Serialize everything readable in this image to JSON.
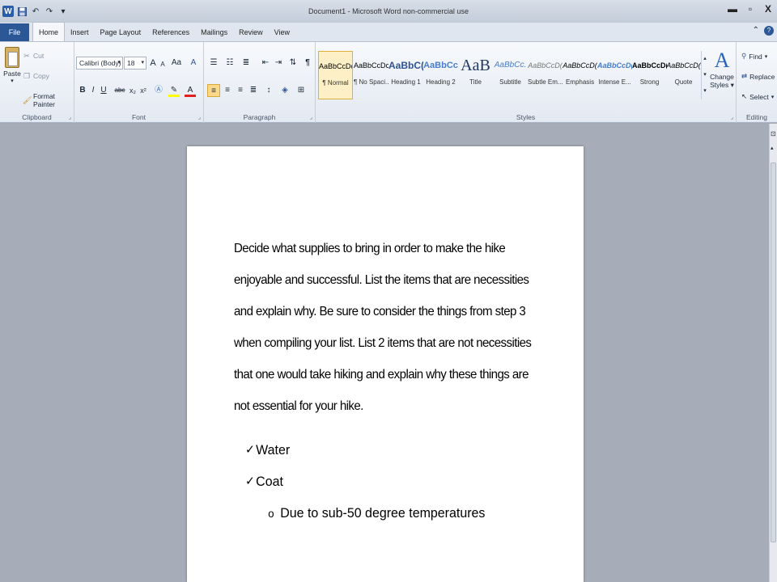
{
  "window": {
    "title": "Document1 - Microsoft Word non-commercial use",
    "app_icon": "W",
    "qat": {
      "save": "save-icon",
      "undo": "↶",
      "redo": "↷",
      "customize": "▾"
    },
    "controls": {
      "minimize": "▬",
      "restore": "▫",
      "close": "X"
    }
  },
  "tabs": [
    "Home",
    "Insert",
    "Page Layout",
    "References",
    "Mailings",
    "Review",
    "View"
  ],
  "file_tab": "File",
  "active_tab": "Home",
  "ribbon": {
    "clipboard": {
      "label": "Clipboard",
      "paste": "Paste",
      "cut": "Cut",
      "copy": "Copy",
      "format_painter": "Format Painter"
    },
    "font": {
      "label": "Font",
      "font_name": "Calibri (Body)",
      "font_size": "18",
      "bold": "B",
      "italic": "I",
      "underline": "U",
      "strike": "abc",
      "subscript": "x₂",
      "superscript": "x²",
      "grow": "A",
      "shrink": "A",
      "case": "Aa",
      "clear": "A"
    },
    "paragraph": {
      "label": "Paragraph",
      "pilcrow": "¶"
    },
    "styles": {
      "label": "Styles",
      "items": [
        {
          "sample": "AaBbCcDc",
          "name": "¶ Normal"
        },
        {
          "sample": "AaBbCcDc",
          "name": "¶ No Spaci..."
        },
        {
          "sample": "AaBbC(",
          "name": "Heading 1"
        },
        {
          "sample": "AaBbCc",
          "name": "Heading 2"
        },
        {
          "sample": "AaB",
          "name": "Title"
        },
        {
          "sample": "AaBbCc.",
          "name": "Subtitle"
        },
        {
          "sample": "AaBbCcD(",
          "name": "Subtle Em..."
        },
        {
          "sample": "AaBbCcD(",
          "name": "Emphasis"
        },
        {
          "sample": "AaBbCcD(",
          "name": "Intense E..."
        },
        {
          "sample": "AaBbCcD(",
          "name": "Strong"
        },
        {
          "sample": "AaBbCcD(",
          "name": "Quote"
        }
      ],
      "change_styles_line1": "Change",
      "change_styles_line2": "Styles"
    },
    "editing": {
      "label": "Editing",
      "find": "Find",
      "replace": "Replace",
      "select": "Select"
    }
  },
  "document": {
    "paragraph_lines": [
      "Decide what supplies to bring in order to make the hike",
      "enjoyable and successful.  List the items that are necessities",
      "and explain why.  Be sure to consider the things from step 3",
      "when compiling your list.  List 2 items that are not necessities",
      "that one would take hiking and explain why these things are",
      "not essential for your hike."
    ],
    "check_mark": "✓",
    "sub_mark": "o",
    "items": [
      "Water",
      "Coat"
    ],
    "sub_item": "Due to sub-50 degree temperatures"
  }
}
